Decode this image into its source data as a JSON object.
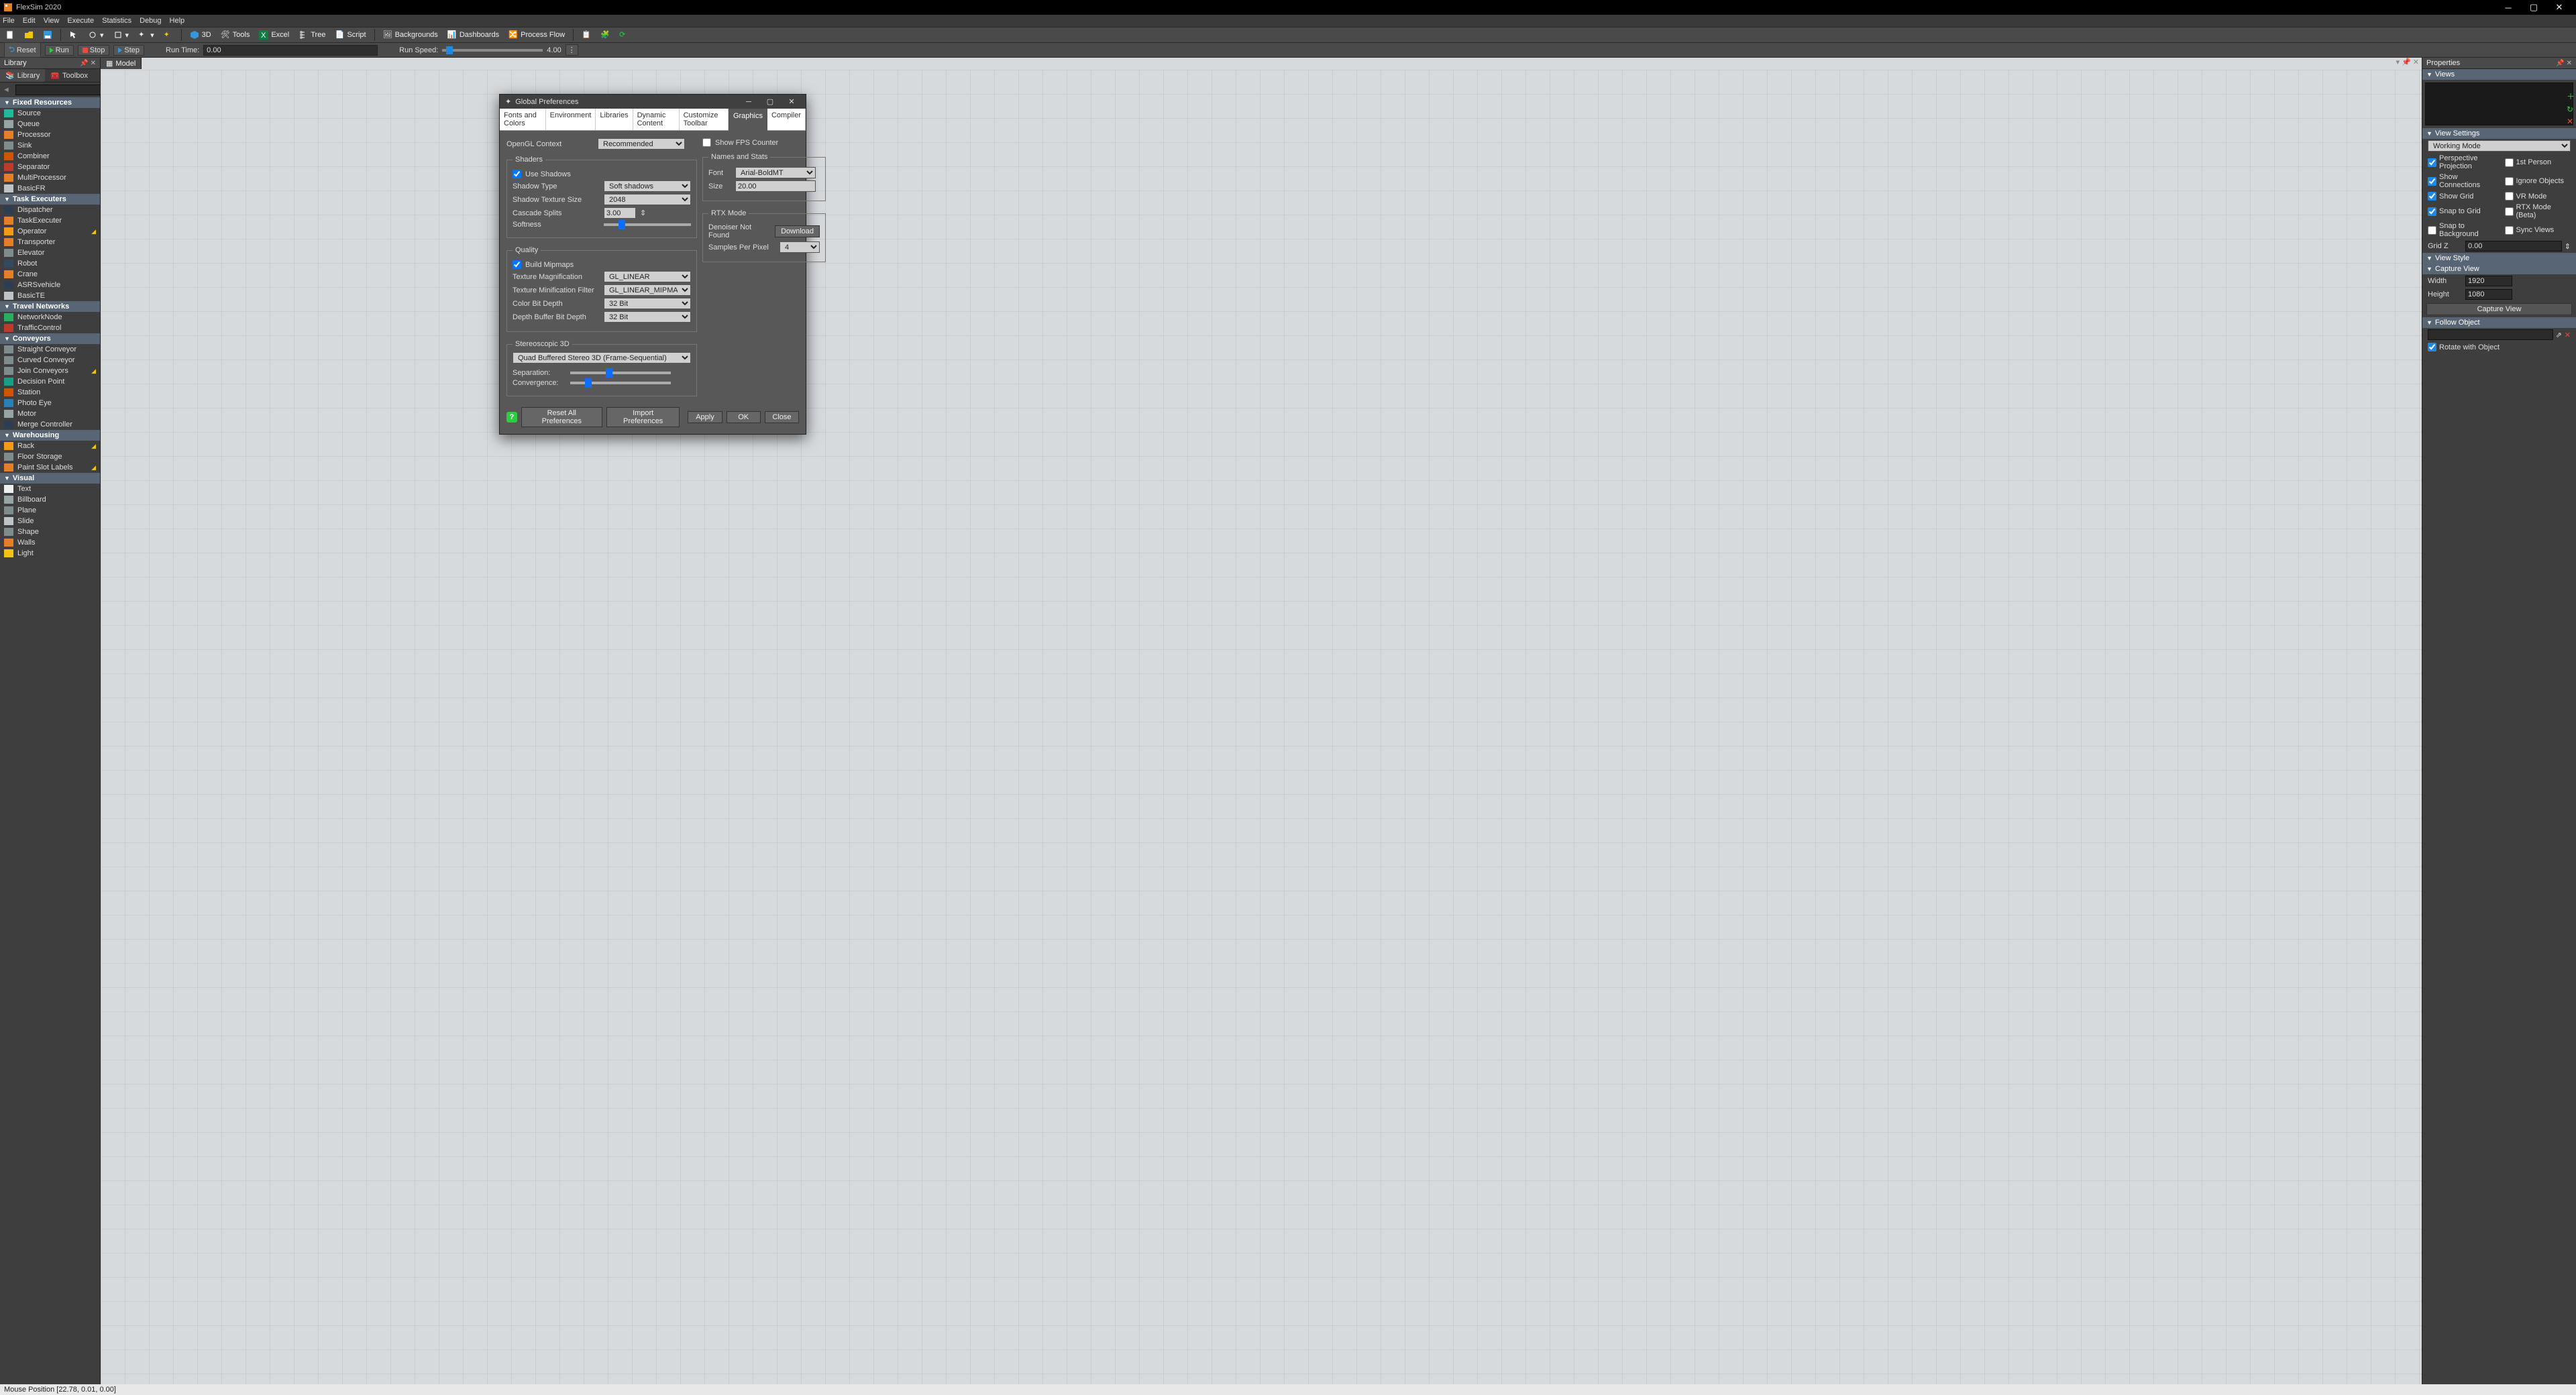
{
  "title": "FlexSim 2020",
  "menu": [
    "File",
    "Edit",
    "View",
    "Execute",
    "Statistics",
    "Debug",
    "Help"
  ],
  "toolbar": {
    "btns": [
      "3D",
      "Tools",
      "Excel",
      "Tree",
      "Script",
      "Backgrounds",
      "Dashboards",
      "Process Flow"
    ]
  },
  "control": {
    "reset": "Reset",
    "run": "Run",
    "stop": "Stop",
    "step": "Step",
    "runtime_label": "Run Time:",
    "runtime_value": "0.00",
    "runspeed_label": "Run Speed:",
    "runspeed_value": "4.00"
  },
  "library": {
    "title": "Library",
    "tabs": [
      "Library",
      "Toolbox"
    ],
    "groups": [
      {
        "name": "Fixed Resources",
        "items": [
          {
            "label": "Source",
            "color": "#1abc9c"
          },
          {
            "label": "Queue",
            "color": "#95a5a6"
          },
          {
            "label": "Processor",
            "color": "#e67e22"
          },
          {
            "label": "Sink",
            "color": "#7f8c8d"
          },
          {
            "label": "Combiner",
            "color": "#d35400"
          },
          {
            "label": "Separator",
            "color": "#c0392b"
          },
          {
            "label": "MultiProcessor",
            "color": "#e67e22"
          },
          {
            "label": "BasicFR",
            "color": "#bdc3c7"
          }
        ]
      },
      {
        "name": "Task Executers",
        "items": [
          {
            "label": "Dispatcher",
            "color": "#2c3e50"
          },
          {
            "label": "TaskExecuter",
            "color": "#e67e22"
          },
          {
            "label": "Operator",
            "color": "#f39c12",
            "pin": true
          },
          {
            "label": "Transporter",
            "color": "#e67e22"
          },
          {
            "label": "Elevator",
            "color": "#7f8c8d"
          },
          {
            "label": "Robot",
            "color": "#34495e"
          },
          {
            "label": "Crane",
            "color": "#e67e22"
          },
          {
            "label": "ASRSvehicle",
            "color": "#2c3e50"
          },
          {
            "label": "BasicTE",
            "color": "#bdc3c7"
          }
        ]
      },
      {
        "name": "Travel Networks",
        "items": [
          {
            "label": "NetworkNode",
            "color": "#27ae60"
          },
          {
            "label": "TrafficControl",
            "color": "#c0392b"
          }
        ]
      },
      {
        "name": "Conveyors",
        "items": [
          {
            "label": "Straight Conveyor",
            "color": "#7f8c8d"
          },
          {
            "label": "Curved Conveyor",
            "color": "#7f8c8d"
          },
          {
            "label": "Join Conveyors",
            "color": "#7f8c8d",
            "pin": true
          },
          {
            "label": "Decision Point",
            "color": "#16a085"
          },
          {
            "label": "Station",
            "color": "#d35400"
          },
          {
            "label": "Photo Eye",
            "color": "#2980b9"
          },
          {
            "label": "Motor",
            "color": "#95a5a6"
          },
          {
            "label": "Merge Controller",
            "color": "#2c3e50"
          }
        ]
      },
      {
        "name": "Warehousing",
        "items": [
          {
            "label": "Rack",
            "color": "#f39c12",
            "pin": true
          },
          {
            "label": "Floor Storage",
            "color": "#7f8c8d"
          },
          {
            "label": "Paint Slot Labels",
            "color": "#e67e22",
            "pin": true
          }
        ]
      },
      {
        "name": "Visual",
        "items": [
          {
            "label": "Text",
            "color": "#ecf0f1"
          },
          {
            "label": "Billboard",
            "color": "#95a5a6"
          },
          {
            "label": "Plane",
            "color": "#7f8c8d"
          },
          {
            "label": "Slide",
            "color": "#bdc3c7"
          },
          {
            "label": "Shape",
            "color": "#7f8c8d"
          },
          {
            "label": "Walls",
            "color": "#e67e22"
          },
          {
            "label": "Light",
            "color": "#f1c40f"
          }
        ]
      }
    ]
  },
  "model_tab": "Model",
  "props": {
    "title": "Properties",
    "views": "Views",
    "view_settings": "View Settings",
    "working_mode": "Working Mode",
    "checks": [
      {
        "l": "Perspective Projection",
        "c": true
      },
      {
        "l": "1st Person",
        "c": false
      },
      {
        "l": "Show Connections",
        "c": true
      },
      {
        "l": "Ignore Objects",
        "c": false
      },
      {
        "l": "Show Grid",
        "c": true
      },
      {
        "l": "VR Mode",
        "c": false
      },
      {
        "l": "Snap to Grid",
        "c": true
      },
      {
        "l": "RTX Mode (Beta)",
        "c": false
      },
      {
        "l": "Snap to Background",
        "c": false
      },
      {
        "l": "Sync Views",
        "c": false
      }
    ],
    "gridz_l": "Grid Z",
    "gridz_v": "0.00",
    "view_style": "View Style",
    "capture_view": "Capture View",
    "width_l": "Width",
    "width_v": "1920",
    "height_l": "Height",
    "height_v": "1080",
    "capture_btn": "Capture View",
    "follow_object": "Follow Object",
    "rotate": "Rotate with Object"
  },
  "dialog": {
    "title": "Global Preferences",
    "tabs": [
      "Fonts and Colors",
      "Environment",
      "Libraries",
      "Dynamic Content",
      "Customize Toolbar",
      "Graphics",
      "Compiler"
    ],
    "active_tab": "Graphics",
    "opengl_l": "OpenGL Context",
    "opengl_v": "Recommended",
    "show_fps": "Show FPS Counter",
    "shaders": "Shaders",
    "use_shadows": "Use Shadows",
    "shadow_type_l": "Shadow Type",
    "shadow_type_v": "Soft shadows",
    "shadow_tex_l": "Shadow Texture Size",
    "shadow_tex_v": "2048",
    "cascade_l": "Cascade Splits",
    "cascade_v": "3.00",
    "softness_l": "Softness",
    "names": "Names and Stats",
    "font_l": "Font",
    "font_v": "Arial-BoldMT",
    "size_l": "Size",
    "size_v": "20.00",
    "rtx": "RTX Mode",
    "denoiser": "Denoiser Not Found",
    "download": "Download",
    "spp_l": "Samples Per Pixel",
    "spp_v": "4",
    "quality": "Quality",
    "mipmaps": "Build Mipmaps",
    "texmag_l": "Texture Magnification",
    "texmag_v": "GL_LINEAR",
    "texmin_l": "Texture Minification Filter",
    "texmin_v": "GL_LINEAR_MIPMAP_LINEAR",
    "cbd_l": "Color Bit Depth",
    "cbd_v": "32 Bit",
    "dbd_l": "Depth Buffer Bit Depth",
    "dbd_v": "32 Bit",
    "stereo": "Stereoscopic 3D",
    "stereo_v": "Quad Buffered Stereo 3D (Frame-Sequential)",
    "sep_l": "Separation:",
    "conv_l": "Convergence:",
    "reset": "Reset All Preferences",
    "import": "Import Preferences",
    "apply": "Apply",
    "ok": "OK",
    "close": "Close"
  },
  "status": "Mouse Position [22.78, 0.01, 0.00]"
}
